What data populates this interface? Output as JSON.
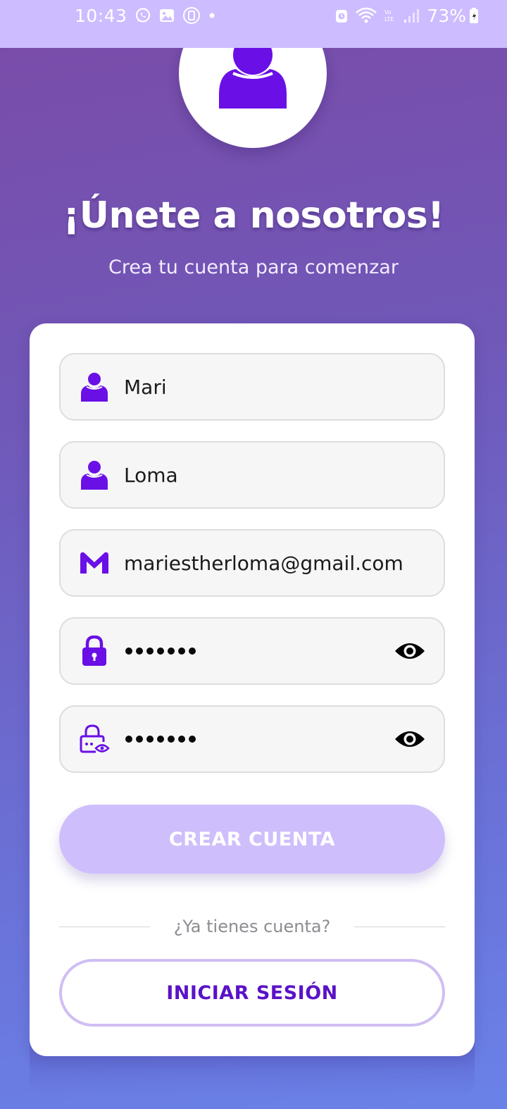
{
  "status_bar": {
    "time": "10:43",
    "battery": "73%",
    "left_icons": [
      "whatsapp-icon",
      "gallery-icon",
      "vibrate-icon",
      "notification-dot-icon"
    ],
    "right_icons": [
      "alarm-icon",
      "wifi-icon",
      "volte-icon",
      "signal-icon",
      "battery-icon"
    ]
  },
  "header": {
    "title": "¡Únete a nosotros!",
    "subtitle": "Crea tu cuenta para comenzar"
  },
  "form": {
    "first_name": {
      "value": "Mari",
      "icon": "person-icon"
    },
    "last_name": {
      "value": "Loma",
      "icon": "person-icon"
    },
    "email": {
      "value": "mariestherloma@gmail.com",
      "icon": "gmail-icon"
    },
    "password": {
      "masked_length": 7,
      "icon": "lock-icon",
      "toggle_icon": "eye-icon"
    },
    "confirm_password": {
      "masked_length": 7,
      "icon": "lock-eye-icon",
      "toggle_icon": "eye-icon"
    },
    "create_button": "CREAR CUENTA",
    "divider_text": "¿Ya tienes cuenta?",
    "login_button": "INICIAR SESIÓN"
  },
  "colors": {
    "accent": "#6a0fe6",
    "status_bar_bg": "#cdbcff",
    "create_button_bg": "#cfbefc",
    "login_button_text": "#5a12c8",
    "login_button_border": "#cfbef3",
    "gradient_top": "#7b4ba8",
    "gradient_bottom": "#6a82e8"
  }
}
